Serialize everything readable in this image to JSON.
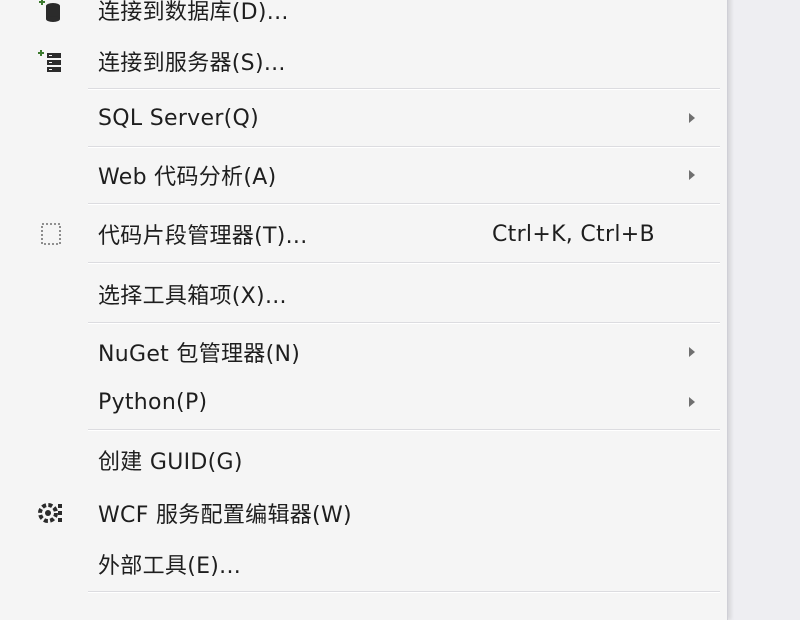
{
  "menu": {
    "items": [
      {
        "label": "连接到数据库(D)...",
        "icon": "database-connect-icon"
      },
      {
        "label": "连接到服务器(S)...",
        "icon": "server-connect-icon"
      },
      {
        "label": "SQL Server(Q)",
        "submenu": true
      },
      {
        "label": "Web 代码分析(A)",
        "submenu": true
      },
      {
        "label": "代码片段管理器(T)...",
        "icon": "snippet-icon",
        "shortcut": "Ctrl+K, Ctrl+B"
      },
      {
        "label": "选择工具箱项(X)..."
      },
      {
        "label": "NuGet 包管理器(N)",
        "submenu": true
      },
      {
        "label": "Python(P)",
        "submenu": true
      },
      {
        "label": "创建 GUID(G)"
      },
      {
        "label": "WCF 服务配置编辑器(W)",
        "icon": "wcf-config-icon"
      },
      {
        "label": "外部工具(E)..."
      }
    ]
  },
  "colors": {
    "menu_background": "#f5f5f5",
    "text": "#1e1e1e",
    "separator": "#dcdce0",
    "arrow": "#707070"
  }
}
